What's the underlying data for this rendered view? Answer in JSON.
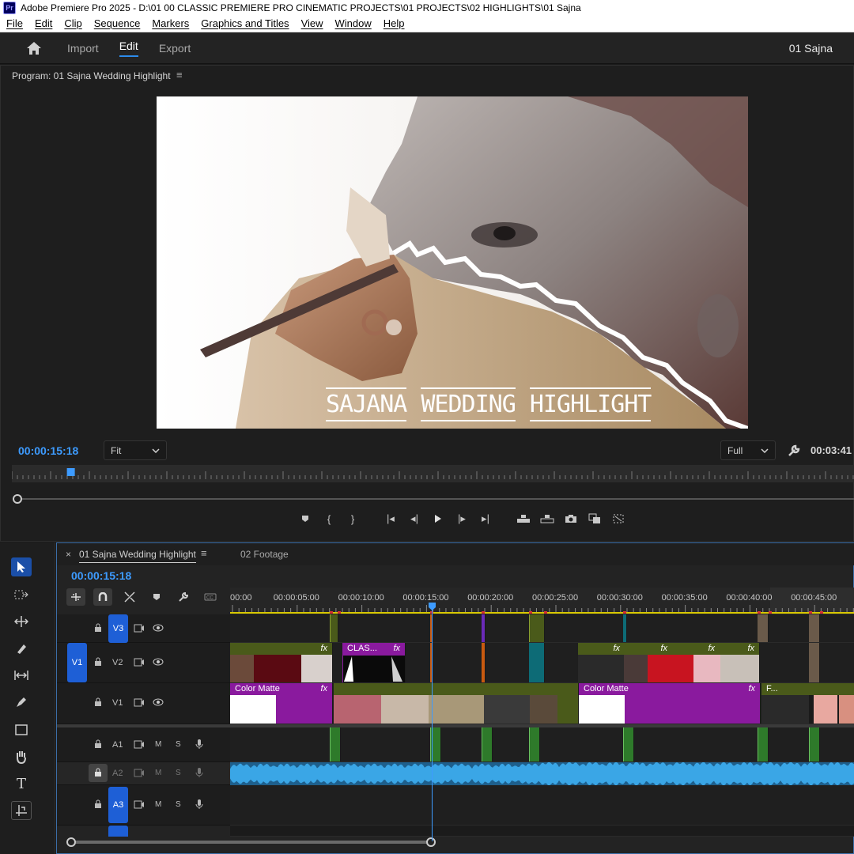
{
  "window": {
    "app_icon": "Pr",
    "title": "Adobe Premiere Pro 2025 - D:\\01 00 CLASSIC PREMIERE PRO CINEMATIC PROJECTS\\01 PROJECTS\\02 HIGHLIGHTS\\01 Sajna"
  },
  "menu": [
    "File",
    "Edit",
    "Clip",
    "Sequence",
    "Markers",
    "Graphics and Titles",
    "View",
    "Window",
    "Help"
  ],
  "header": {
    "tabs": [
      "Import",
      "Edit",
      "Export"
    ],
    "active_tab": "Edit",
    "project_name": "01 Sajna"
  },
  "program": {
    "title": "Program: 01 Sajna Wedding Highlight",
    "menu_glyph": "≡",
    "current_time": "00:00:15:18",
    "zoom": "Fit",
    "quality": "Full",
    "duration": "00:03:41",
    "title_words": [
      "SAJANA",
      "WEDDING",
      "HIGHLIGHT"
    ],
    "playhead_fraction": 0.07
  },
  "timeline": {
    "tabs": [
      "01 Sajna Wedding Highlight",
      "02 Footage"
    ],
    "close_glyph": "×",
    "menu_glyph": "≡",
    "current_time": "00:00:15:18",
    "ruler_labels": [
      "00:00",
      "00:00:05:00",
      "00:00:10:00",
      "00:00:15:00",
      "00:00:20:00",
      "00:00:25:00",
      "00:00:30:00",
      "00:00:35:00",
      "00:00:40:00",
      "00:00:45:00"
    ],
    "tracks": {
      "v3": "V3",
      "v2": "V2",
      "v1": "V1",
      "v1_source": "V1",
      "a1": "A1",
      "a2": "A2",
      "a3": "A3",
      "mute": "M",
      "solo": "S"
    },
    "clips": {
      "v2_title": "CLAS...",
      "v1_color_matte_1": "Color Matte",
      "v1_color_matte_2": "Color Matte",
      "v1_f": "F...",
      "fx": "fx"
    }
  },
  "colors": {
    "accent": "#3d9bff",
    "track_label_blue": "#1e5fd6",
    "clip_green": "#4a5a1a",
    "clip_purple": "#8a1a9e",
    "audio_waveform": "#3aa6e6",
    "audio_marker_green": "#2e7a2a"
  }
}
